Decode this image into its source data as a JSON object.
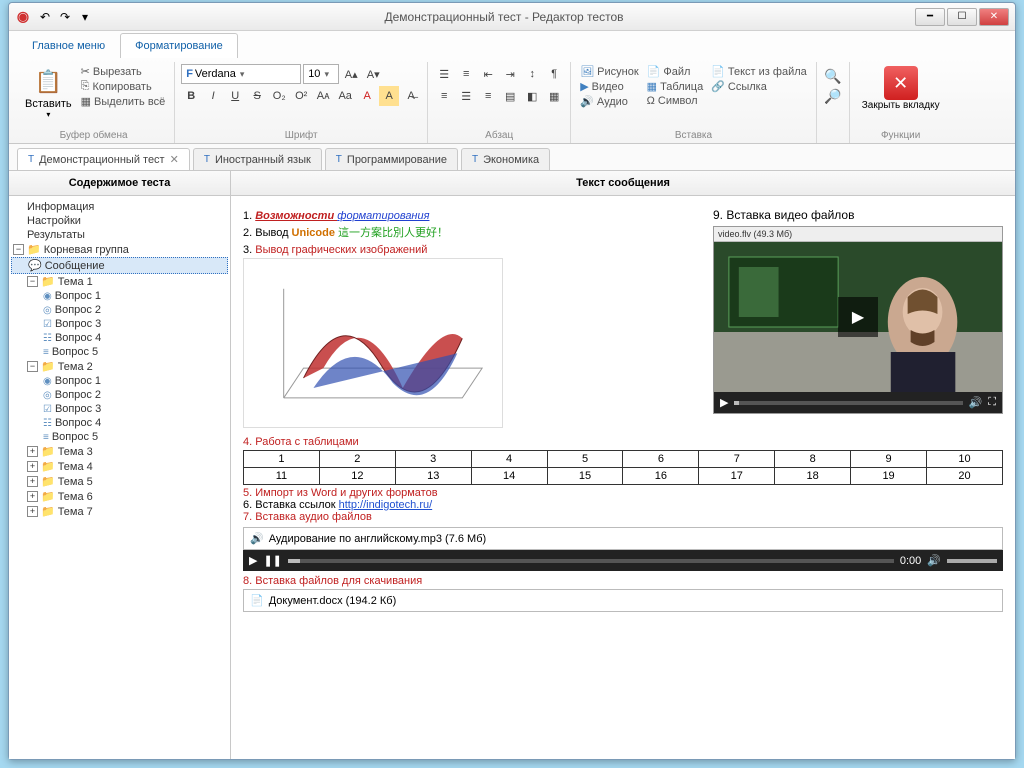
{
  "window": {
    "title": "Демонстрационный тест - Редактор тестов"
  },
  "qat": {
    "undo": "↶",
    "redo": "↷"
  },
  "menubar": {
    "main": "Главное меню",
    "formatting": "Форматирование"
  },
  "ribbon": {
    "clipboard": {
      "paste": "Вставить",
      "cut": "Вырезать",
      "copy": "Копировать",
      "select_all": "Выделить всё",
      "group": "Буфер обмена"
    },
    "font": {
      "name": "Verdana",
      "size": "10",
      "group": "Шрифт",
      "bold": "B",
      "italic": "I",
      "underline": "U",
      "strike": "S",
      "sub": "O₂",
      "sup": "O²",
      "fontcolor": "A",
      "highlight": "A",
      "clear": "A"
    },
    "paragraph": {
      "group": "Абзац"
    },
    "insert": {
      "image": "Рисунок",
      "file": "Файл",
      "video": "Видео",
      "table": "Таблица",
      "audio": "Аудио",
      "symbol": "Символ",
      "text_from_file": "Текст из файла",
      "link": "Ссылка",
      "group": "Вставка"
    },
    "functions": {
      "close": "Закрыть вкладку",
      "group": "Функции"
    }
  },
  "tabs": [
    {
      "label": "Демонстрационный тест",
      "active": true,
      "closable": true
    },
    {
      "label": "Иностранный язык",
      "active": false
    },
    {
      "label": "Программирование",
      "active": false
    },
    {
      "label": "Экономика",
      "active": false
    }
  ],
  "side": {
    "header": "Содержимое теста",
    "items": {
      "info": "Информация",
      "settings": "Настройки",
      "results": "Результаты",
      "root": "Корневая группа",
      "message": "Сообщение",
      "theme1": "Тема 1",
      "theme2": "Тема 2",
      "theme3": "Тема 3",
      "theme4": "Тема 4",
      "theme5": "Тема 5",
      "theme6": "Тема 6",
      "theme7": "Тема 7",
      "q1": "Вопрос 1",
      "q2": "Вопрос 2",
      "q3": "Вопрос 3",
      "q4": "Вопрос 4",
      "q5": "Вопрос 5"
    }
  },
  "content": {
    "header": "Текст сообщения",
    "lines": {
      "l1a": "1. ",
      "l1b": "Возможности ",
      "l1c": "форматирования",
      "l2a": "2. Вывод ",
      "l2b": "Unicode ",
      "l2c": "這一方案比別人更好！",
      "l3a": "3. ",
      "l3b": "Вывод графических изображений",
      "l4": "4. Работа с таблицами",
      "l5": "5. Импорт из Word и других форматов",
      "l6a": "6. Вставка ссылок ",
      "l6b": "http://indigotech.ru/",
      "l7": "7. Вставка аудио файлов",
      "l8": "8. Вставка файлов для скачивания",
      "l9": "9. Вставка видео файлов"
    },
    "table": {
      "row1": [
        "1",
        "2",
        "3",
        "4",
        "5",
        "6",
        "7",
        "8",
        "9",
        "10"
      ],
      "row2": [
        "11",
        "12",
        "13",
        "14",
        "15",
        "16",
        "17",
        "18",
        "19",
        "20"
      ]
    },
    "audio": {
      "title": "Аудирование по английскому.mp3 (7.6 Мб)",
      "time": "0:00"
    },
    "video": {
      "titlebar": "video.flv (49.3 Мб)"
    },
    "file": {
      "title": "Документ.docx (194.2 Кб)"
    }
  },
  "chart_data": {
    "type": "surface3d",
    "title": "",
    "xlabel": "",
    "ylabel": "",
    "zlabel": "",
    "x_range": [
      -3,
      3
    ],
    "y_range": [
      -3,
      3
    ],
    "z_range": [
      -1,
      1
    ],
    "note": "saddle-like 3D surface, red high z, blue low z"
  }
}
